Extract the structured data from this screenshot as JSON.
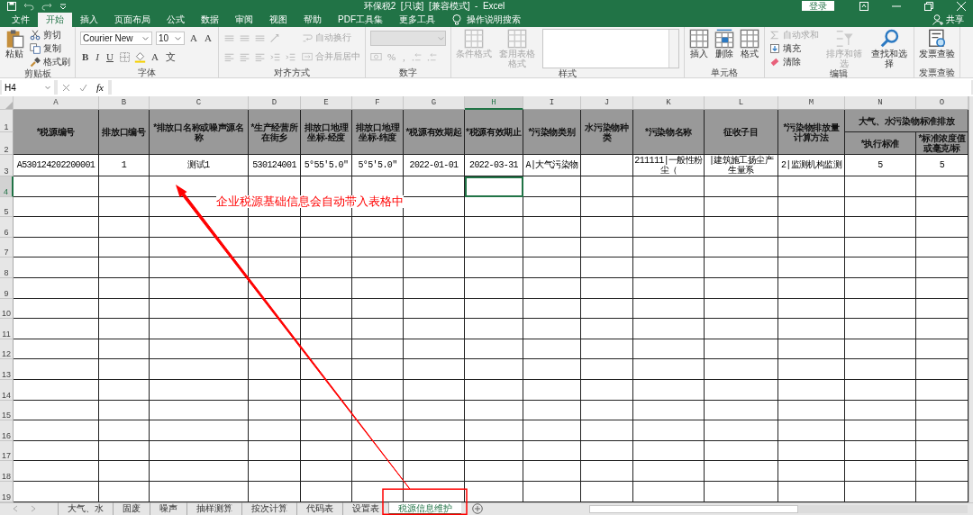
{
  "title_bar": {
    "title": "环保税2  [只读]  [兼容模式]  -  Excel",
    "login": "登录"
  },
  "menu_tabs": [
    {
      "label": "文件",
      "selected": false
    },
    {
      "label": "开始",
      "selected": true
    },
    {
      "label": "插入",
      "selected": false
    },
    {
      "label": "页面布局",
      "selected": false
    },
    {
      "label": "公式",
      "selected": false
    },
    {
      "label": "数据",
      "selected": false
    },
    {
      "label": "审阅",
      "selected": false
    },
    {
      "label": "视图",
      "selected": false
    },
    {
      "label": "帮助",
      "selected": false
    },
    {
      "label": "PDF工具集",
      "selected": false
    },
    {
      "label": "更多工具",
      "selected": false
    }
  ],
  "tell_me": "操作说明搜索",
  "share": "共享",
  "ribbon_groups": [
    {
      "label": "剪贴板",
      "stacks": [
        [
          [
            {
              "kind": "big",
              "label": "粘贴",
              "disabled": false
            }
          ]
        ],
        [
          [
            {
              "kind": "small",
              "label": "剪切",
              "disabled": false
            }
          ],
          [
            {
              "kind": "small",
              "label": "复制",
              "disabled": false
            }
          ],
          [
            {
              "kind": "small",
              "label": "格式刷",
              "disabled": false
            }
          ]
        ]
      ]
    },
    {
      "label": "字体",
      "stacks": [
        [
          [
            {
              "kind": "field",
              "label": "Courier New",
              "disabled": false
            },
            {
              "kind": "field",
              "label": "10",
              "disabled": false
            },
            {
              "kind": "text",
              "label": "A",
              "disabled": false
            },
            {
              "kind": "text",
              "label": "A",
              "disabled": false
            }
          ],
          [
            {
              "kind": "text",
              "label": "B",
              "disabled": false
            },
            {
              "kind": "text",
              "label": "I",
              "disabled": false
            },
            {
              "kind": "text",
              "label": "U",
              "disabled": false
            },
            {
              "kind": "icon",
              "disabled": false
            },
            {
              "kind": "icon",
              "disabled": false
            },
            {
              "kind": "text",
              "label": "A",
              "disabled": false
            },
            {
              "kind": "text",
              "label": "文",
              "disabled": false
            }
          ]
        ]
      ]
    },
    {
      "label": "对齐方式",
      "stacks": [
        [
          [
            {
              "kind": "icon",
              "disabled": true
            },
            {
              "kind": "icon",
              "disabled": true
            },
            {
              "kind": "icon",
              "disabled": true
            },
            {
              "kind": "icon",
              "disabled": true
            }
          ],
          [
            {
              "kind": "icon",
              "disabled": true
            },
            {
              "kind": "icon",
              "disabled": true
            },
            {
              "kind": "icon",
              "disabled": true
            },
            {
              "kind": "icon",
              "disabled": true
            },
            {
              "kind": "icon",
              "disabled": true
            }
          ]
        ],
        [
          [
            {
              "kind": "small",
              "label": "自动换行",
              "disabled": true
            }
          ],
          [
            {
              "kind": "small",
              "label": "合并后居中",
              "disabled": true
            }
          ]
        ]
      ]
    },
    {
      "label": "数字",
      "stacks": [
        [
          [
            {
              "kind": "dropdown",
              "disabled": true
            }
          ],
          [
            {
              "kind": "icon",
              "disabled": true
            },
            {
              "kind": "text",
              "label": "%",
              "disabled": true
            },
            {
              "kind": "text",
              "label": ",",
              "disabled": true
            },
            {
              "kind": "icon",
              "disabled": true
            },
            {
              "kind": "icon",
              "disabled": true
            }
          ]
        ]
      ]
    },
    {
      "label": "样式",
      "stacks": [
        [
          [
            {
              "kind": "big",
              "label": "条件格式",
              "disabled": true
            }
          ]
        ],
        [
          [
            {
              "kind": "big",
              "label": "套用表格格式",
              "disabled": true
            }
          ]
        ],
        [
          [
            {
              "kind": "gallery"
            }
          ]
        ]
      ]
    },
    {
      "label": "单元格",
      "stacks": [
        [
          [
            {
              "kind": "big",
              "label": "插入",
              "disabled": false
            }
          ]
        ],
        [
          [
            {
              "kind": "big",
              "label": "删除",
              "disabled": false
            }
          ]
        ],
        [
          [
            {
              "kind": "big",
              "label": "格式",
              "disabled": false
            }
          ]
        ]
      ]
    },
    {
      "label": "编辑",
      "stacks": [
        [
          [
            {
              "kind": "small",
              "label": "自动求和",
              "disabled": true
            }
          ],
          [
            {
              "kind": "small",
              "label": "填充",
              "disabled": false
            }
          ],
          [
            {
              "kind": "small",
              "label": "清除",
              "disabled": false
            }
          ]
        ],
        [
          [
            {
              "kind": "big",
              "label": "排序和筛选",
              "disabled": true
            }
          ]
        ],
        [
          [
            {
              "kind": "big",
              "label": "查找和选择",
              "disabled": false
            }
          ]
        ]
      ]
    },
    {
      "label": "发票查验",
      "stacks": [
        [
          [
            {
              "kind": "big",
              "label": "发票查验",
              "disabled": false
            }
          ]
        ]
      ]
    }
  ],
  "formula_bar": {
    "name_box": "H4",
    "fx": "fx"
  },
  "columns": [
    {
      "letter": "A",
      "selected": false
    },
    {
      "letter": "B",
      "selected": false
    },
    {
      "letter": "C",
      "selected": false
    },
    {
      "letter": "D",
      "selected": false
    },
    {
      "letter": "E",
      "selected": false
    },
    {
      "letter": "F",
      "selected": false
    },
    {
      "letter": "G",
      "selected": false
    },
    {
      "letter": "H",
      "selected": true
    },
    {
      "letter": "I",
      "selected": false
    },
    {
      "letter": "J",
      "selected": false
    },
    {
      "letter": "K",
      "selected": false
    },
    {
      "letter": "L",
      "selected": false
    },
    {
      "letter": "M",
      "selected": false
    },
    {
      "letter": "N",
      "selected": false
    },
    {
      "letter": "O",
      "selected": false
    }
  ],
  "row_headers": [
    {
      "number": "1",
      "selected": false
    },
    {
      "number": "2",
      "selected": false
    },
    {
      "number": "3",
      "selected": false
    },
    {
      "number": "4",
      "selected": true
    },
    {
      "number": "5",
      "selected": false
    },
    {
      "number": "6",
      "selected": false
    },
    {
      "number": "7",
      "selected": false
    },
    {
      "number": "8",
      "selected": false
    },
    {
      "number": "9",
      "selected": false
    },
    {
      "number": "10",
      "selected": false
    },
    {
      "number": "11",
      "selected": false
    },
    {
      "number": "12",
      "selected": false
    },
    {
      "number": "13",
      "selected": false
    },
    {
      "number": "14",
      "selected": false
    },
    {
      "number": "15",
      "selected": false
    },
    {
      "number": "16",
      "selected": false
    },
    {
      "number": "17",
      "selected": false
    },
    {
      "number": "18",
      "selected": false
    },
    {
      "number": "19",
      "selected": false
    }
  ],
  "header_cells": [
    "*税源编号",
    "排放口编号",
    "*排放口名称或噪声源名称",
    "*生产经营所在街乡",
    "排放口地理坐标-经度",
    "排放口地理坐标-纬度",
    "*税源有效期起",
    "*税源有效期止",
    "*污染物类别",
    "水污染物种类",
    "*污染物名称",
    "征收子目",
    "*污染物排放量计算方法"
  ],
  "header_group": {
    "text": "大气、水污染物标准排放",
    "children": [
      "*执行标准",
      "*标准浓度值或毫克/标"
    ]
  },
  "table_rows": [
    {
      "cells": [
        "A530124202200001",
        "1",
        "测试1",
        "530124001",
        "5°55'5.0\"",
        "5°5'5.0\"",
        "2022-01-01",
        "2022-03-31",
        "A|大气污染物",
        null,
        "211111|一般性粉尘（",
        "|建筑施工扬尘产生量系",
        "2|监测机构监测",
        "5",
        "5"
      ]
    }
  ],
  "sheet_tabs": [
    {
      "label": "大气、水",
      "selected": false
    },
    {
      "label": "固废",
      "selected": false
    },
    {
      "label": "噪声",
      "selected": false
    },
    {
      "label": "抽样测算",
      "selected": false
    },
    {
      "label": "按次计算",
      "selected": false
    },
    {
      "label": "代码表",
      "selected": false
    },
    {
      "label": "设置表",
      "selected": false
    },
    {
      "label": "税源信息维护",
      "selected": true
    }
  ],
  "annotation": {
    "text": "企业税源基础信息会自动带入表格中"
  }
}
